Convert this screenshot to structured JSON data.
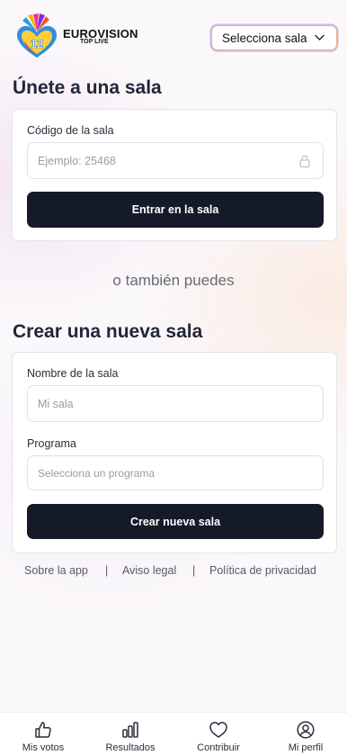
{
  "header": {
    "logo_line1": "EUROVISION",
    "logo_line2": "TOP LIVE",
    "logo_badge": "12",
    "room_select_label": "Selecciona sala"
  },
  "join": {
    "title": "Únete a una sala",
    "code_label": "Código de la sala",
    "code_placeholder": "Ejemplo: 25468",
    "submit_label": "Entrar en la sala"
  },
  "divider": "o también puedes",
  "create": {
    "title": "Crear una nueva sala",
    "name_label": "Nombre de la sala",
    "name_placeholder": "Mi sala",
    "program_label": "Programa",
    "program_placeholder": "Selecciona un programa",
    "submit_label": "Crear nueva sala"
  },
  "footer": {
    "links": [
      "Sobre la app",
      "Aviso legal",
      "Política de privacidad"
    ]
  },
  "tabbar": {
    "items": [
      {
        "label": "Mis votos",
        "icon": "thumbs-up-icon"
      },
      {
        "label": "Resultados",
        "icon": "bar-chart-icon"
      },
      {
        "label": "Contribuir",
        "icon": "heart-icon"
      },
      {
        "label": "Mi perfil",
        "icon": "user-circle-icon"
      }
    ]
  },
  "colors": {
    "primary_button": "#141a27",
    "select_border": "#f2b27a",
    "select_glow": "#c8b8ef"
  }
}
